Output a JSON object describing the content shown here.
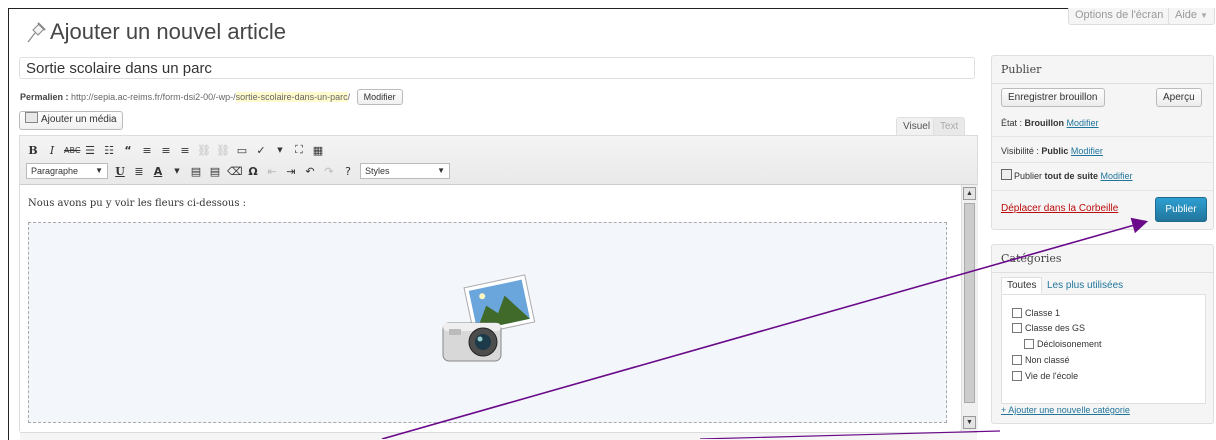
{
  "screen_options": {
    "label": "Options de l'écran",
    "help": "Aide"
  },
  "page": {
    "title": "Ajouter un nouvel article"
  },
  "post": {
    "title": "Sortie scolaire dans un parc",
    "permalink_label": "Permalien :",
    "permalink_base": "http://sepia.ac-reims.fr/form-dsi2-00/-wp-/",
    "permalink_slug": "sortie-scolaire-dans-un-parc",
    "permalink_end": "/",
    "modify_label": "Modifier"
  },
  "editor": {
    "add_media": "Ajouter un média",
    "tab_visual": "Visuel",
    "tab_text": "Text",
    "format_select": "Paragraphe",
    "styles_select": "Styles",
    "content_text": "Nous avons pu y voir les fleurs ci-dessous :"
  },
  "publish_box": {
    "title": "Publier",
    "save_draft": "Enregistrer brouillon",
    "preview": "Aperçu",
    "state_label": "État :",
    "state_value": "Brouillon",
    "visibility_label": "Visibilité :",
    "visibility_value": "Public",
    "publish_prefix": "Publier",
    "publish_when": "tout de suite",
    "modify": "Modifier",
    "trash": "Déplacer dans la Corbeille",
    "publish_button": "Publier"
  },
  "categories_box": {
    "title": "Catégories",
    "tab_all": "Toutes",
    "tab_popular": "Les plus utilisées",
    "items": [
      "Classe 1",
      "Classe des GS",
      "Décloisonement",
      "Non classé",
      "Vie de l'école"
    ],
    "add_link": "+ Ajouter une nouvelle catégorie"
  },
  "colors": {
    "accent": "#21759b",
    "trash": "#bc0b0b",
    "arrow": "#6a0a8a"
  }
}
